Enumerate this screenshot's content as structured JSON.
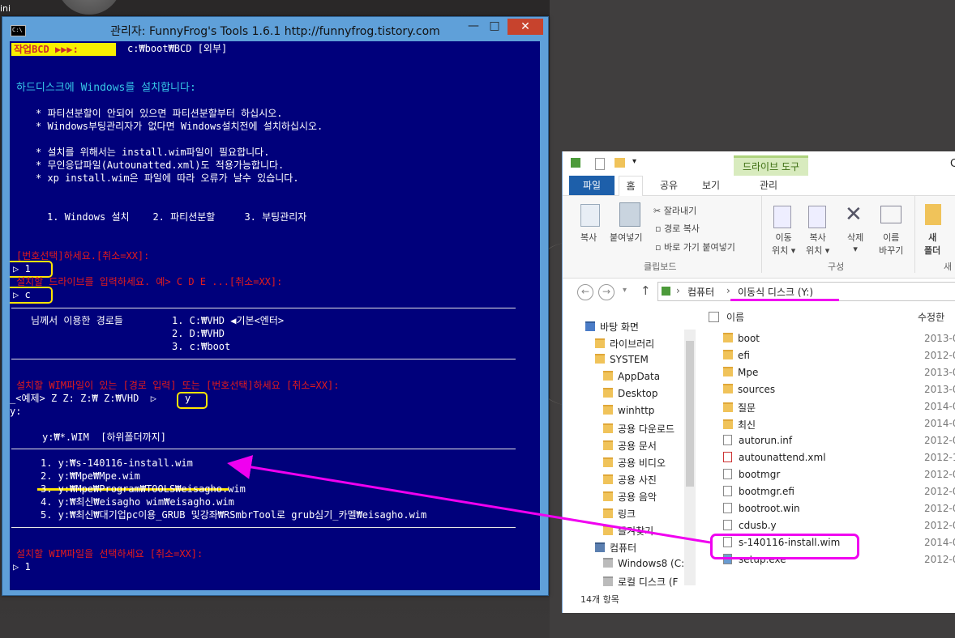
{
  "desktop": {
    "corner_text": "ini"
  },
  "console": {
    "title": "관리자:  FunnyFrog's Tools 1.6.1    http://funnyfrog.tistory.com",
    "controls": {
      "minimize": "—",
      "maximize": "□",
      "close": "✕"
    },
    "header_badge": "작업BCD ▶▶▶:",
    "header_bcd": "c:₩boot₩BCD [외부]",
    "line_title": "하드디스크에 Windows를 설치합니다:",
    "bullets1": [
      "* 파티션분할이 안되어 있으면 파티션분할부터 하십시오.",
      "* Windows부팅관리자가 없다면 Windows설치전에 설치하십시오."
    ],
    "bullets2": [
      "* 설치를 위해서는 install.wim파일이 필요합니다.",
      "* 무인응답파일(Autounatted.xml)도 적용가능합니다.",
      "* xp install.wim은 파일에 따라 오류가 날수 있습니다."
    ],
    "menu": "1. Windows 설치    2. 파티션분할     3. 부팅관리자",
    "prompt_select": "[번호선택]하세요.[취소=XX]:",
    "input1": "▷ 1",
    "prompt_drive": "설치할 드라이브를 입력하세요. 예> C D E ...[취소=XX]:",
    "input2": "▷ c",
    "paths_label": "님께서 이용한 경로들",
    "paths": [
      "1. C:₩VHD ◀기본<엔터>",
      "2. D:₩VHD",
      "3. c:₩boot"
    ],
    "prompt_wim": "설치할 WIM파일이 있는 [경로 입력] 또는 [번호선택]하세요 [취소=XX]:",
    "example_line": "_<예제> Z Z: Z:₩ Z:₩VHD  ▷",
    "input3": "y",
    "y_line": "y:",
    "search_line": "y:₩*.WIM  [하위폴더까지]",
    "wim_list": [
      "1. y:₩s-140116-install.wim",
      "2. y:₩Mpe₩Mpe.wim",
      "3. y:₩Mpe₩Program₩TOOLS₩eisagho.wim",
      "4. y:₩최신₩eisagho wim₩eisagho.wim",
      "5. y:₩최신₩대기업pc이용_GRUB 및강좌₩RSmbrTool로 grub심기_카멜₩eisagho.wim"
    ],
    "prompt_choose": "설치할 WIM파일을 선택하세요 [취소=XX]:",
    "input4": "▷ 1"
  },
  "explorer": {
    "title_clip": "C",
    "drive_tools": "드라이브 도구",
    "tabs": [
      "파일",
      "홈",
      "공유",
      "보기",
      "관리"
    ],
    "ribbon": {
      "copy": "복사",
      "paste": "붙여넣기",
      "cut": "잘라내기",
      "copy_path": "경로 복사",
      "paste_shortcut": "바로 가기 붙여넣기",
      "clipboard": "클립보드",
      "move_to": [
        "이동",
        "위치 ▾"
      ],
      "copy_to": [
        "복사",
        "위치 ▾"
      ],
      "delete": [
        "삭제",
        "▾"
      ],
      "rename": [
        "이름",
        "바꾸기"
      ],
      "organize": "구성",
      "new_folder": [
        "새",
        "폴더"
      ],
      "new_clip": "새"
    },
    "address": {
      "computer": "컴퓨터",
      "drive": "이동식 디스크 (Y:)"
    },
    "nav": [
      {
        "label": "바탕 화면",
        "type": "desktop"
      },
      {
        "label": "라이브러리",
        "type": "library"
      },
      {
        "label": "SYSTEM",
        "type": "user"
      },
      {
        "label": "AppData",
        "type": "folder"
      },
      {
        "label": "Desktop",
        "type": "folder"
      },
      {
        "label": "winhttp",
        "type": "folder"
      },
      {
        "label": "공용 다운로드",
        "type": "folder"
      },
      {
        "label": "공용 문서",
        "type": "folder"
      },
      {
        "label": "공용 비디오",
        "type": "folder"
      },
      {
        "label": "공용 사진",
        "type": "folder"
      },
      {
        "label": "공용 음악",
        "type": "folder"
      },
      {
        "label": "링크",
        "type": "folder"
      },
      {
        "label": "즐겨찾기",
        "type": "folder"
      },
      {
        "label": "컴퓨터",
        "type": "computer"
      },
      {
        "label": "Windows8 (C:)",
        "type": "drive"
      },
      {
        "label": "로컬 디스크 (F",
        "type": "drive"
      }
    ],
    "columns": {
      "name": "이름",
      "date": "수정한"
    },
    "files": [
      {
        "name": "boot",
        "date": "2013-0",
        "type": "folder"
      },
      {
        "name": "efi",
        "date": "2012-0",
        "type": "folder"
      },
      {
        "name": "Mpe",
        "date": "2013-0",
        "type": "folder"
      },
      {
        "name": "sources",
        "date": "2013-0",
        "type": "folder"
      },
      {
        "name": "질문",
        "date": "2014-0",
        "type": "folder"
      },
      {
        "name": "최신",
        "date": "2014-0",
        "type": "folder"
      },
      {
        "name": "autorun.inf",
        "date": "2012-0",
        "type": "file"
      },
      {
        "name": "autounattend.xml",
        "date": "2012-1",
        "type": "file"
      },
      {
        "name": "bootmgr",
        "date": "2012-0",
        "type": "file"
      },
      {
        "name": "bootmgr.efi",
        "date": "2012-0",
        "type": "file"
      },
      {
        "name": "bootroot.win",
        "date": "2012-0",
        "type": "file"
      },
      {
        "name": "cdusb.y",
        "date": "2012-0",
        "type": "file"
      },
      {
        "name": "s-140116-install.wim",
        "date": "2014-0",
        "type": "file"
      },
      {
        "name": "setup.exe",
        "date": "2012-0",
        "type": "file"
      }
    ],
    "status": "14개 항목",
    "colors": {
      "annotation": "#f000f0",
      "highlight": "#ffe500",
      "console_bg": "#00007b"
    }
  }
}
